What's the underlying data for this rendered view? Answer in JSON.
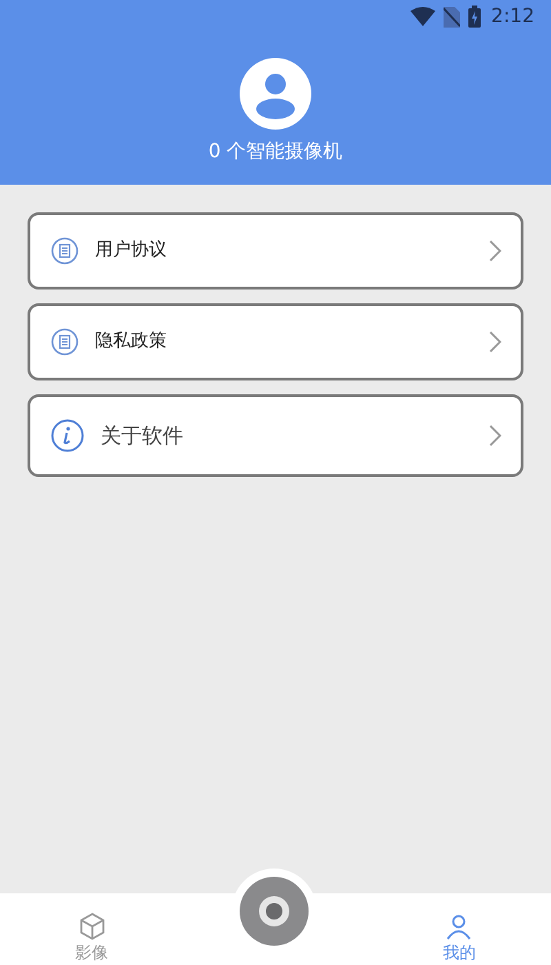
{
  "status_bar": {
    "time": "2:12"
  },
  "header": {
    "camera_count": "0 个智能摄像机"
  },
  "menu": [
    {
      "label": "用户协议",
      "kind": "document"
    },
    {
      "label": "隐私政策",
      "kind": "document"
    },
    {
      "label": "关于软件",
      "kind": "info"
    }
  ],
  "bottom_nav": [
    {
      "label": "影像",
      "kind": "cube",
      "selected": false
    },
    {
      "kind": "camera"
    },
    {
      "label": "我的",
      "kind": "person",
      "selected": true
    }
  ]
}
